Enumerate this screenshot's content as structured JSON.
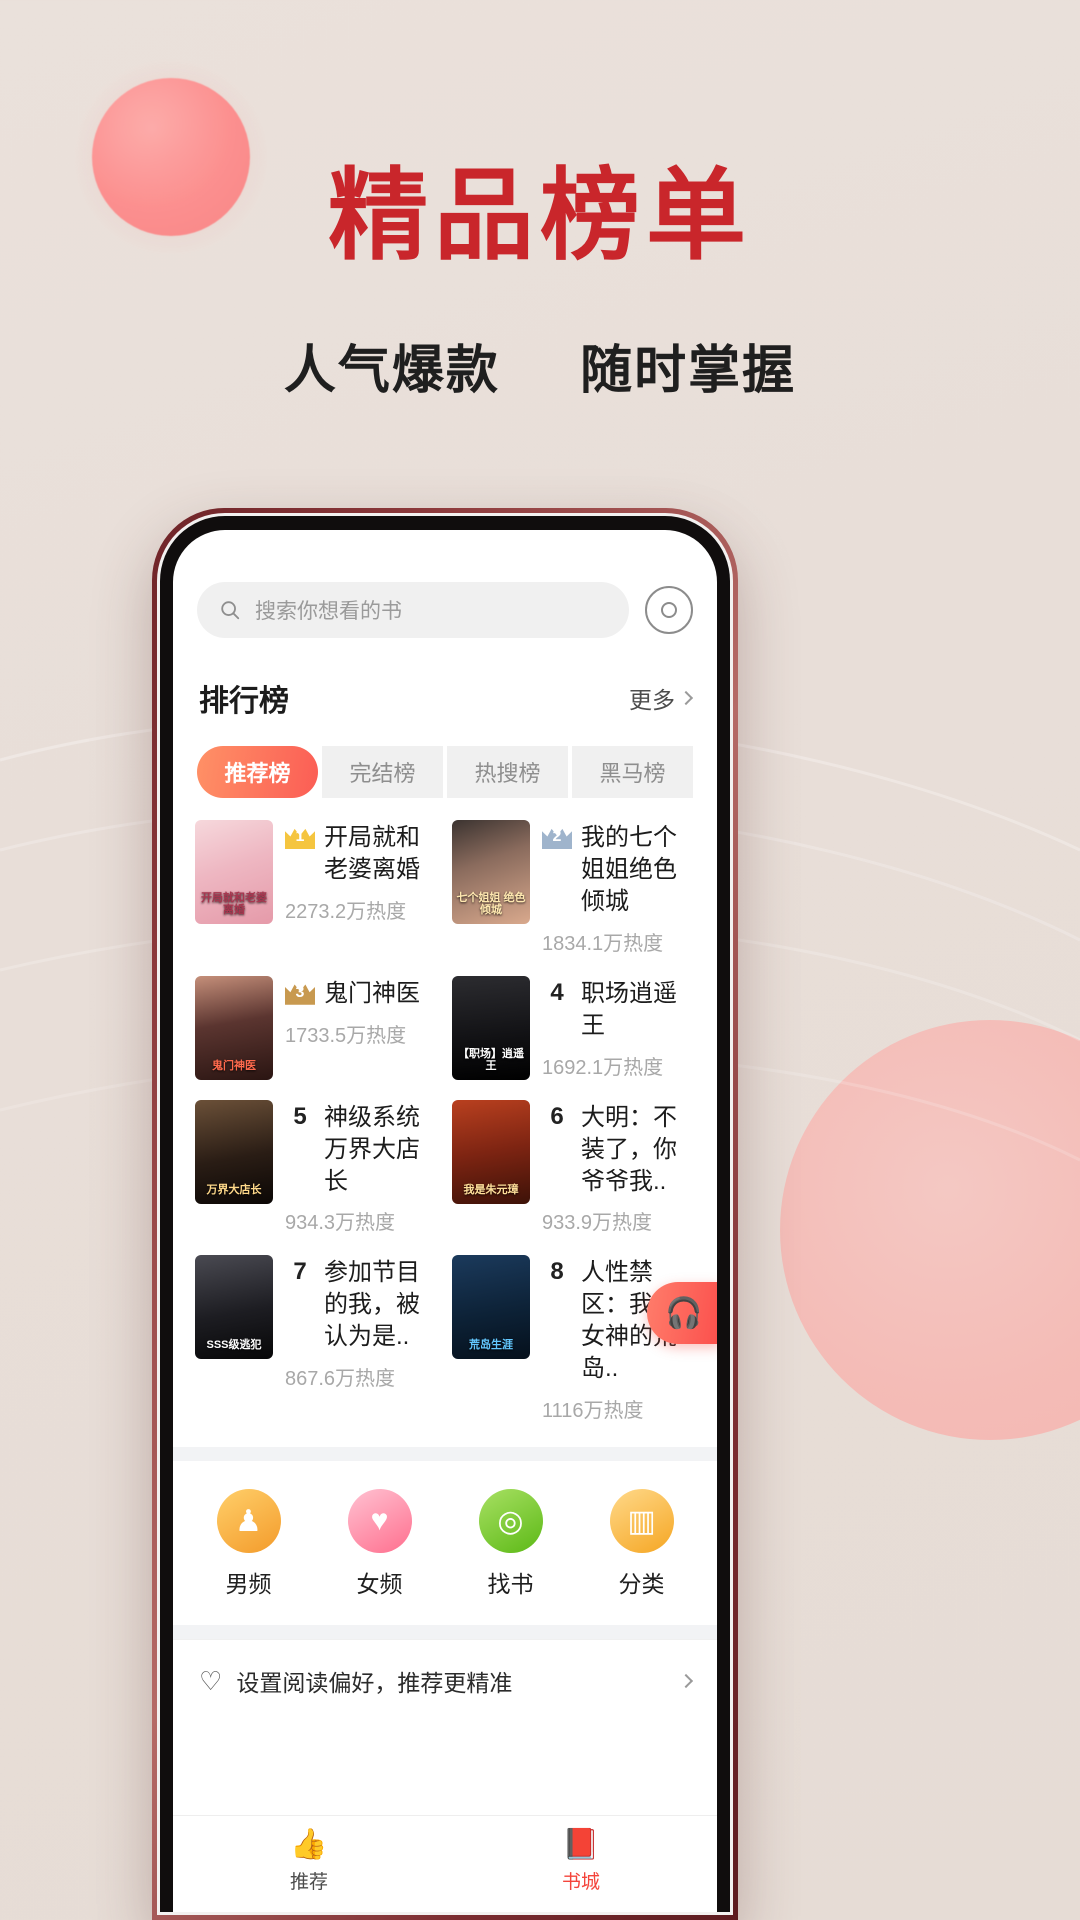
{
  "promo": {
    "title": "精品榜单",
    "subtitle_left": "人气爆款",
    "subtitle_right": "随时掌握",
    "title_color": "#c9262b",
    "subtitle_color": "#1f1f1f",
    "background_color": "#e8ded8"
  },
  "app": {
    "search": {
      "placeholder": "搜索你想看的书",
      "icon": "search-icon",
      "scan_icon": "scan-circle-icon"
    },
    "section": {
      "title": "排行榜",
      "more_label": "更多",
      "more_icon": "chevron-right-icon"
    },
    "tabs": [
      {
        "label": "推荐榜",
        "active": true
      },
      {
        "label": "完结榜",
        "active": false
      },
      {
        "label": "热搜榜",
        "active": false
      },
      {
        "label": "黑马榜",
        "active": false
      }
    ],
    "accent_color": "#fb5d55",
    "books": [
      {
        "rank": "1",
        "badge_style": "crown-gold",
        "title": "开局就和老婆离婚",
        "heat": "2273.2万热度",
        "cover_label": "开局就和老婆离婚",
        "cover_bg": "linear-gradient(160deg,#f6d8dc 0%,#eeb7c2 45%,#e59aa9 100%)",
        "cover_text_color": "#a8364f"
      },
      {
        "rank": "2",
        "badge_style": "crown-silver",
        "title": "我的七个姐姐绝色倾城",
        "heat": "1834.1万热度",
        "cover_label": "七个姐姐 绝色倾城",
        "cover_bg": "linear-gradient(160deg,#3b3330 0%,#8a6b5d 40%,#d9a98d 100%)",
        "cover_text_color": "#ffe8b0"
      },
      {
        "rank": "3",
        "badge_style": "crown-bronze",
        "title": "鬼门神医",
        "heat": "1733.5万热度",
        "cover_label": "鬼门神医",
        "cover_bg": "linear-gradient(170deg,#c58f7a 0%,#5b3530 45%,#2a1512 100%)",
        "cover_text_color": "#ff6a4d"
      },
      {
        "rank": "4",
        "badge_style": "plain",
        "title": "职场逍遥王",
        "heat": "1692.1万热度",
        "cover_label": "【职场】逍遥王",
        "cover_bg": "linear-gradient(175deg,#2c2c30 0%,#131316 55%,#000 100%)",
        "cover_text_color": "#ffffff"
      },
      {
        "rank": "5",
        "badge_style": "plain",
        "title": "神级系统万界大店长",
        "heat": "934.3万热度",
        "cover_label": "万界大店长",
        "cover_bg": "linear-gradient(170deg,#6b5038 0%,#2a1d15 55%,#0b0705 100%)",
        "cover_text_color": "#ffd98a"
      },
      {
        "rank": "6",
        "badge_style": "plain",
        "title": "大明：不装了，你爷爷我..",
        "heat": "933.9万热度",
        "cover_label": "我是朱元璋",
        "cover_bg": "linear-gradient(170deg,#b9401f 0%,#7d2412 50%,#3d1208 100%)",
        "cover_text_color": "#ffdf9a"
      },
      {
        "rank": "7",
        "badge_style": "plain",
        "title": "参加节目的我，被认为是..",
        "heat": "867.6万热度",
        "cover_label": "SSS级逃犯",
        "cover_bg": "linear-gradient(170deg,#4a4a52 0%,#1d1d22 55%,#070708 100%)",
        "cover_text_color": "#ffffff"
      },
      {
        "rank": "8",
        "badge_style": "plain",
        "title": "人性禁区：我和女神的荒岛..",
        "heat": "1116万热度",
        "cover_label": "荒岛生涯",
        "cover_bg": "linear-gradient(170deg,#1b3a5c 0%,#0d2237 55%,#05101c 100%)",
        "cover_text_color": "#63c8ff"
      }
    ],
    "categories": [
      {
        "label": "男频",
        "icon": "male-channel-icon",
        "color": "#f5a623"
      },
      {
        "label": "女频",
        "icon": "female-channel-icon",
        "color": "#ff6f8e"
      },
      {
        "label": "找书",
        "icon": "find-book-icon",
        "color": "#7ac943"
      },
      {
        "label": "分类",
        "icon": "category-icon",
        "color": "#f7b733"
      }
    ],
    "preference": {
      "icon": "heart-icon",
      "text": "设置阅读偏好，推荐更精准",
      "chevron": "chevron-right-icon"
    },
    "audio_fab": {
      "icon": "headphones-icon"
    },
    "bottom_nav": [
      {
        "label": "推荐",
        "icon": "thumbs-up-icon",
        "active": false
      },
      {
        "label": "书城",
        "icon": "book-store-icon",
        "active": true
      }
    ]
  }
}
